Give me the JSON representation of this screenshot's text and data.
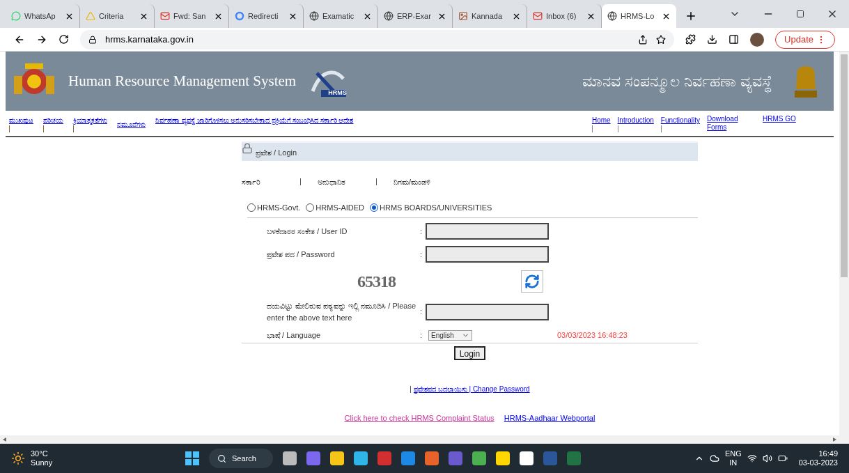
{
  "browser": {
    "tabs": [
      {
        "title": "WhatsAp",
        "selected": false
      },
      {
        "title": "Criteria",
        "selected": false
      },
      {
        "title": "Fwd: San",
        "selected": false
      },
      {
        "title": "Redirecti",
        "selected": false
      },
      {
        "title": "Examatic",
        "selected": false
      },
      {
        "title": "ERP-Exar",
        "selected": false
      },
      {
        "title": "Kannada",
        "selected": false
      },
      {
        "title": "Inbox (6)",
        "selected": false
      },
      {
        "title": "HRMS-Lo",
        "selected": true
      }
    ],
    "address": "hrms.karnataka.gov.in",
    "update_button": "Update"
  },
  "header": {
    "title": "Human Resource Management System",
    "logo_text": "HRMS",
    "title_kn": "ಮಾನವ ಸಂಪನ್ಮೂಲ ನಿರ್ವಹಣಾ ವ್ಯವಸ್ಥೆ"
  },
  "nav_left": [
    "ಮುಖಪುಟ",
    "ಪರಿಚಯ",
    "ಕ್ರಿಯಾತ್ಮಕತೆಗಳು",
    "ನಮೂನೆಗಳು",
    "ನಿರ್ವಹಣಾ ವ್ಯವಸ್ಥೆ ಜಾರಿಗೊಳಿಸಲು ಅನುಸರಿಸಬೇಕಾದ ಪ್ರಕ್ರಿಯೆಗೆ ಸಂಬಂಧಿಸಿದ ಸರ್ಕಾರಿ ಆದೇಶ"
  ],
  "nav_right": [
    "Home",
    "Introduction",
    "Functionality",
    "Download Forms",
    "HRMS GO"
  ],
  "login": {
    "title": "ಪ್ರವೇಶ / Login",
    "categories": [
      "ಸರ್ಕಾರಿ",
      "ಅನುಧಾನಿತ",
      "ನಿಗಮ/ಮಂಡಳಿ"
    ],
    "radios": [
      {
        "label": "HRMS-Govt.",
        "selected": false
      },
      {
        "label": "HRMS-AIDED",
        "selected": false
      },
      {
        "label": "HRMS BOARDS/UNIVERSITIES",
        "selected": true
      }
    ],
    "fields": [
      {
        "kind": "input",
        "label": "ಬಳಕೆದಾರರ ಸಂಕೇತ / User ID"
      },
      {
        "kind": "input",
        "label": "ಪ್ರವೇಶ ಪದ / Password"
      },
      {
        "kind": "captcha",
        "captcha": "65318"
      },
      {
        "kind": "input",
        "label": "ದಯವಿಟ್ಟು ಮೇಲಿರುವ ಪಠ್ಯವನ್ನು ಇಲ್ಲಿ ನಮೂದಿಸಿ / Please enter the above text here"
      },
      {
        "kind": "select",
        "label": "ಭಾಷೆ / Language",
        "value": "English",
        "datetime": "03/03/2023 16:48:23"
      }
    ],
    "colon": ":",
    "button": "Login",
    "change_password": {
      "separator": "|",
      "link": "ಪ್ರವೇಶಪದ ಬದಲಾಯಿಸು | Change Password"
    },
    "links": [
      {
        "label": "Click here to check HRMS Complaint Status",
        "color": "#cc3399"
      },
      {
        "label": "HRMS-Aadhaar Webportal",
        "color": "#0000ee"
      }
    ]
  },
  "taskbar": {
    "temperature": "30°C",
    "weather": "Sunny",
    "search": "Search",
    "lang": "ENG",
    "region": "IN",
    "time": "16:49",
    "date": "03-03-2023"
  }
}
